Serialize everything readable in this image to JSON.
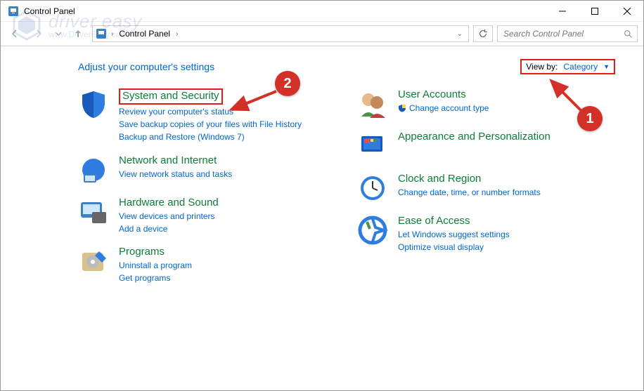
{
  "window": {
    "title": "Control Panel"
  },
  "nav": {
    "breadcrumb": [
      "Control Panel"
    ],
    "search_placeholder": "Search Control Panel"
  },
  "page": {
    "heading": "Adjust your computer's settings",
    "viewby_label": "View by:",
    "viewby_value": "Category"
  },
  "left": [
    {
      "title": "System and Security",
      "links": [
        "Review your computer's status",
        "Save backup copies of your files with File History",
        "Backup and Restore (Windows 7)"
      ],
      "highlight": true
    },
    {
      "title": "Network and Internet",
      "links": [
        "View network status and tasks"
      ]
    },
    {
      "title": "Hardware and Sound",
      "links": [
        "View devices and printers",
        "Add a device"
      ]
    },
    {
      "title": "Programs",
      "links": [
        "Uninstall a program",
        "Get programs"
      ]
    }
  ],
  "right": [
    {
      "title": "User Accounts",
      "links": [
        "Change account type"
      ],
      "shield": true
    },
    {
      "title": "Appearance and Personalization",
      "links": []
    },
    {
      "title": "Clock and Region",
      "links": [
        "Change date, time, or number formats"
      ]
    },
    {
      "title": "Ease of Access",
      "links": [
        "Let Windows suggest settings",
        "Optimize visual display"
      ]
    }
  ],
  "annotations": {
    "bubble1": "1",
    "bubble2": "2"
  },
  "watermark": {
    "brand_top": "driver easy",
    "brand_sub": "www.DriverEasy.com"
  }
}
